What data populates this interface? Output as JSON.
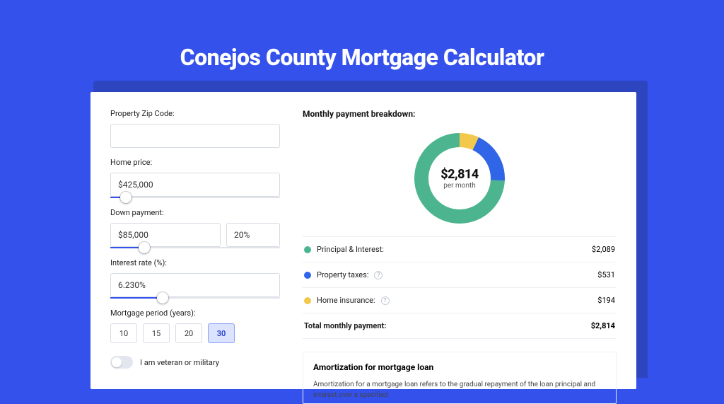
{
  "title": "Conejos County Mortgage Calculator",
  "colors": {
    "pi": "#4cb58f",
    "tax": "#2f65e6",
    "ins": "#f2c94c"
  },
  "form": {
    "zip": {
      "label": "Property Zip Code:",
      "value": ""
    },
    "home_price": {
      "label": "Home price:",
      "value": "$425,000",
      "slider_pct": 9
    },
    "down_payment": {
      "label": "Down payment:",
      "value": "$85,000",
      "pct": "20%",
      "slider_pct": 20
    },
    "interest": {
      "label": "Interest rate (%):",
      "value": "6.230%",
      "slider_pct": 31
    },
    "period": {
      "label": "Mortgage period (years):",
      "options": [
        "10",
        "15",
        "20",
        "30"
      ],
      "selected": "30"
    },
    "veteran": {
      "label": "I am veteran or military",
      "on": false
    }
  },
  "monthly": {
    "heading": "Monthly payment breakdown:",
    "total_display": "$2,814",
    "per": "per month",
    "rows": [
      {
        "label": "Principal & Interest:",
        "value": "$2,089",
        "color": "pi",
        "help": false
      },
      {
        "label": "Property taxes:",
        "value": "$531",
        "color": "tax",
        "help": true
      },
      {
        "label": "Home insurance:",
        "value": "$194",
        "color": "ins",
        "help": true
      }
    ],
    "total_row": {
      "label": "Total monthly payment:",
      "value": "$2,814"
    }
  },
  "amort": {
    "heading": "Amortization for mortgage loan",
    "body": "Amortization for a mortgage loan refers to the gradual repayment of the loan principal and interest over a specified"
  },
  "chart_data": {
    "type": "pie",
    "title": "Monthly payment breakdown",
    "center_value": 2814,
    "center_label": "per month",
    "series": [
      {
        "name": "Principal & Interest",
        "value": 2089,
        "color": "#4cb58f"
      },
      {
        "name": "Property taxes",
        "value": 531,
        "color": "#2f65e6"
      },
      {
        "name": "Home insurance",
        "value": 194,
        "color": "#f2c94c"
      }
    ]
  }
}
